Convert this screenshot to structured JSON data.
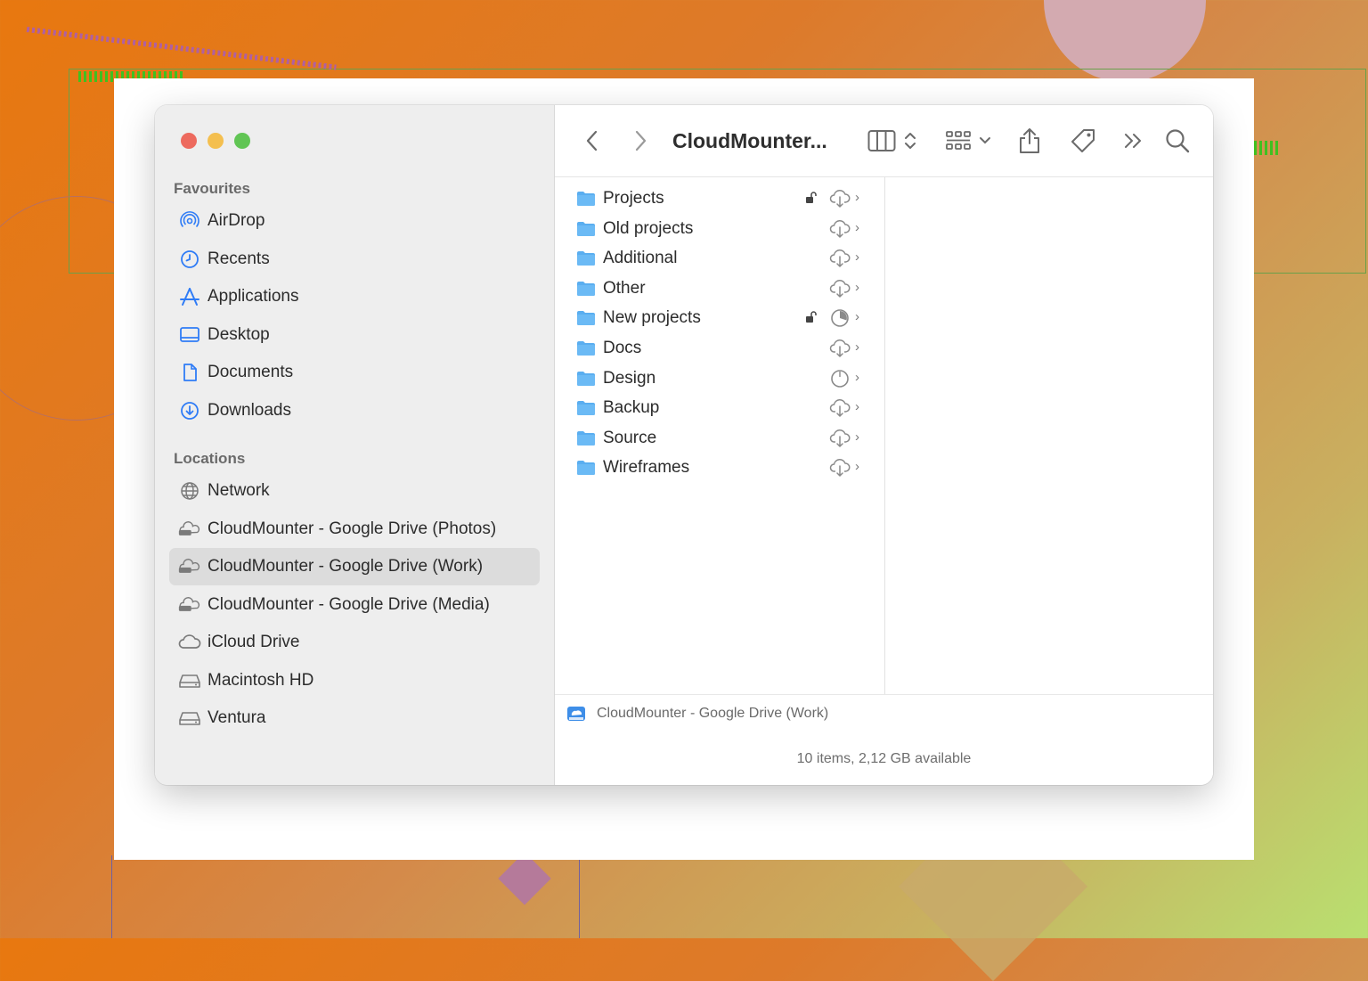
{
  "window": {
    "title": "CloudMounter...",
    "status": "10 items, 2,12 GB available"
  },
  "sidebar": {
    "favourites_title": "Favourites",
    "favourites": [
      {
        "label": "AirDrop",
        "icon": "airdrop-icon"
      },
      {
        "label": "Recents",
        "icon": "clock-icon"
      },
      {
        "label": "Applications",
        "icon": "applications-icon"
      },
      {
        "label": "Desktop",
        "icon": "desktop-icon"
      },
      {
        "label": "Documents",
        "icon": "document-icon"
      },
      {
        "label": "Downloads",
        "icon": "download-icon"
      }
    ],
    "locations_title": "Locations",
    "locations": [
      {
        "label": "Network",
        "icon": "globe-icon"
      },
      {
        "label": "CloudMounter - Google Drive (Photos)",
        "icon": "cloud-drive-icon"
      },
      {
        "label": "CloudMounter - Google Drive (Work)",
        "icon": "cloud-drive-icon",
        "selected": true
      },
      {
        "label": "CloudMounter - Google Drive (Media)",
        "icon": "cloud-drive-icon"
      },
      {
        "label": "iCloud Drive",
        "icon": "cloud-icon"
      },
      {
        "label": "Macintosh HD",
        "icon": "disk-icon"
      },
      {
        "label": "Ventura",
        "icon": "disk-icon"
      }
    ]
  },
  "files": [
    {
      "name": "Projects",
      "locked": true,
      "status": "cloud-download-icon"
    },
    {
      "name": "Old projects",
      "locked": false,
      "status": "cloud-download-icon"
    },
    {
      "name": "Additional",
      "locked": false,
      "status": "cloud-download-icon"
    },
    {
      "name": "Other",
      "locked": false,
      "status": "cloud-download-icon"
    },
    {
      "name": "New projects",
      "locked": true,
      "status": "progress-icon"
    },
    {
      "name": "Docs",
      "locked": false,
      "status": "cloud-download-icon"
    },
    {
      "name": "Design",
      "locked": false,
      "status": "progress-empty-icon"
    },
    {
      "name": "Backup",
      "locked": false,
      "status": "cloud-download-icon"
    },
    {
      "name": "Source",
      "locked": false,
      "status": "cloud-download-icon"
    },
    {
      "name": "Wireframes",
      "locked": false,
      "status": "cloud-download-icon"
    }
  ],
  "pathbar": {
    "label": "CloudMounter - Google Drive (Work)"
  },
  "colors": {
    "accent": "#2f7cf6",
    "folder": "#5aaef0",
    "red": "#ed6a5e",
    "yellow": "#f4bf4f",
    "green": "#61c554"
  }
}
